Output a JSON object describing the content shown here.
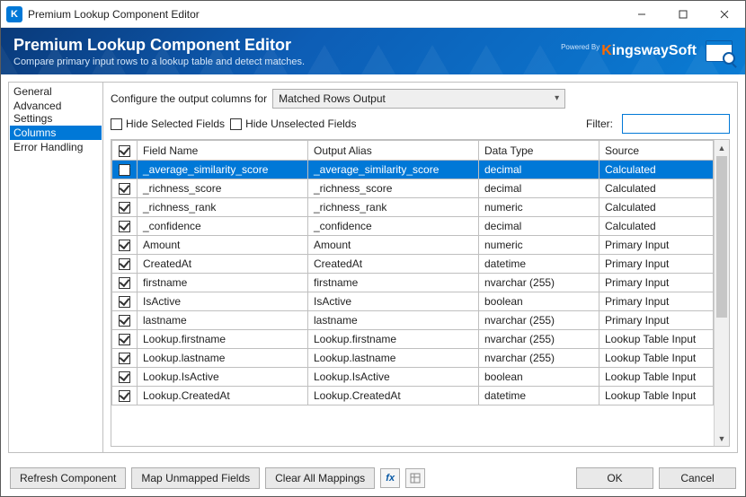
{
  "title": "Premium Lookup Component Editor",
  "app_letter": "K",
  "banner": {
    "title": "Premium Lookup Component Editor",
    "subtitle": "Compare primary input rows to a lookup table and detect matches.",
    "powered": "Powered By",
    "brand_k": "K",
    "brand_rest": "ingswaySoft"
  },
  "sidebar": {
    "items": [
      "General",
      "Advanced Settings",
      "Columns",
      "Error Handling"
    ],
    "selected_index": 2
  },
  "config": {
    "label": "Configure the output columns for",
    "selected": "Matched Rows Output"
  },
  "options": {
    "hide_selected": "Hide Selected Fields",
    "hide_unselected": "Hide Unselected Fields",
    "filter_label": "Filter:",
    "filter_value": ""
  },
  "table": {
    "headers": {
      "field_name": "Field Name",
      "output_alias": "Output Alias",
      "data_type": "Data Type",
      "source": "Source"
    },
    "rows": [
      {
        "checked": true,
        "selected": true,
        "field_name": "_average_similarity_score",
        "output_alias": "_average_similarity_score",
        "data_type": "decimal",
        "source": "Calculated"
      },
      {
        "checked": true,
        "selected": false,
        "field_name": "_richness_score",
        "output_alias": "_richness_score",
        "data_type": "decimal",
        "source": "Calculated"
      },
      {
        "checked": true,
        "selected": false,
        "field_name": "_richness_rank",
        "output_alias": "_richness_rank",
        "data_type": "numeric",
        "source": "Calculated"
      },
      {
        "checked": true,
        "selected": false,
        "field_name": "_confidence",
        "output_alias": "_confidence",
        "data_type": "decimal",
        "source": "Calculated"
      },
      {
        "checked": true,
        "selected": false,
        "field_name": "Amount",
        "output_alias": "Amount",
        "data_type": "numeric",
        "source": "Primary Input"
      },
      {
        "checked": true,
        "selected": false,
        "field_name": "CreatedAt",
        "output_alias": "CreatedAt",
        "data_type": "datetime",
        "source": "Primary Input"
      },
      {
        "checked": true,
        "selected": false,
        "field_name": "firstname",
        "output_alias": "firstname",
        "data_type": "nvarchar (255)",
        "source": "Primary Input"
      },
      {
        "checked": true,
        "selected": false,
        "field_name": "IsActive",
        "output_alias": "IsActive",
        "data_type": "boolean",
        "source": "Primary Input"
      },
      {
        "checked": true,
        "selected": false,
        "field_name": "lastname",
        "output_alias": "lastname",
        "data_type": "nvarchar (255)",
        "source": "Primary Input"
      },
      {
        "checked": true,
        "selected": false,
        "field_name": "Lookup.firstname",
        "output_alias": "Lookup.firstname",
        "data_type": "nvarchar (255)",
        "source": "Lookup Table Input"
      },
      {
        "checked": true,
        "selected": false,
        "field_name": "Lookup.lastname",
        "output_alias": "Lookup.lastname",
        "data_type": "nvarchar (255)",
        "source": "Lookup Table Input"
      },
      {
        "checked": true,
        "selected": false,
        "field_name": "Lookup.IsActive",
        "output_alias": "Lookup.IsActive",
        "data_type": "boolean",
        "source": "Lookup Table Input"
      },
      {
        "checked": true,
        "selected": false,
        "field_name": "Lookup.CreatedAt",
        "output_alias": "Lookup.CreatedAt",
        "data_type": "datetime",
        "source": "Lookup Table Input"
      }
    ]
  },
  "footer": {
    "refresh": "Refresh Component",
    "map": "Map Unmapped Fields",
    "clear": "Clear All Mappings",
    "ok": "OK",
    "cancel": "Cancel"
  }
}
